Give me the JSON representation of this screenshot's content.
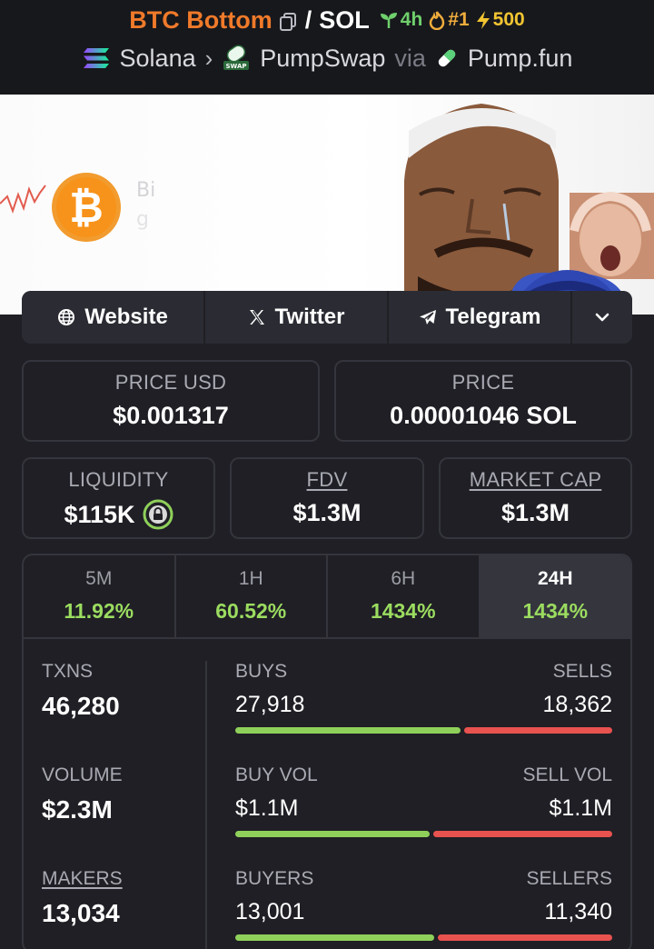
{
  "header": {
    "token_name": "BTC Bottom",
    "slash": "/",
    "quote": "SOL",
    "age": "4h",
    "rank": "#1",
    "boosts": "500"
  },
  "route": {
    "chain": "Solana",
    "dex": "PumpSwap",
    "via": "via",
    "launchpad": "Pump.fun"
  },
  "banner": {
    "partial_text_1": "Bi",
    "partial_text_2": "g"
  },
  "links": {
    "website": "Website",
    "twitter": "Twitter",
    "telegram": "Telegram"
  },
  "prices": {
    "usd_label": "PRICE USD",
    "usd_value": "$0.001317",
    "native_label": "PRICE",
    "native_value": "0.00001046 SOL"
  },
  "stats": {
    "liquidity_label": "LIQUIDITY",
    "liquidity_value": "$115K",
    "fdv_label": "FDV",
    "fdv_value": "$1.3M",
    "mcap_label": "MARKET CAP",
    "mcap_value": "$1.3M"
  },
  "timeframes": [
    {
      "label": "5M",
      "change": "11.92%"
    },
    {
      "label": "1H",
      "change": "60.52%"
    },
    {
      "label": "6H",
      "change": "1434%"
    },
    {
      "label": "24H",
      "change": "1434%"
    }
  ],
  "metrics": {
    "txns_label": "TXNS",
    "txns_value": "46,280",
    "buys_label": "BUYS",
    "buys_value": "27,918",
    "sells_label": "SELLS",
    "sells_value": "18,362",
    "buy_share": 0.603,
    "volume_label": "VOLUME",
    "volume_value": "$2.3M",
    "buy_vol_label": "BUY VOL",
    "buy_vol_value": "$1.1M",
    "sell_vol_label": "SELL VOL",
    "sell_vol_value": "$1.1M",
    "buy_vol_share": 0.52,
    "makers_label": "MAKERS",
    "makers_value": "13,034",
    "buyers_label": "BUYERS",
    "buyers_value": "13,001",
    "sellers_label": "SELLERS",
    "sellers_value": "11,340",
    "buyer_share": 0.534
  },
  "colors": {
    "token_name": "#f07a2a",
    "positive": "#9bdc60",
    "buy_bar": "#8fd05a",
    "sell_bar": "#e8524f",
    "liquidity_lock": "#8fd05a"
  }
}
